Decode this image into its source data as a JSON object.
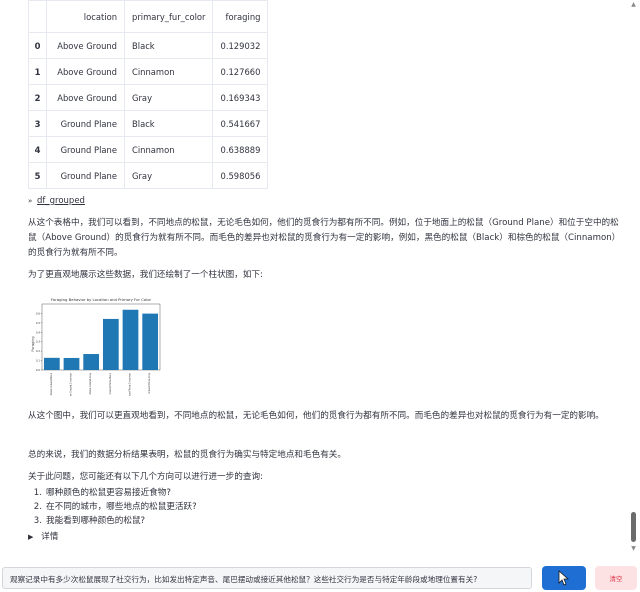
{
  "table": {
    "columns": [
      "",
      "location",
      "primary_fur_color",
      "foraging"
    ],
    "rows": [
      {
        "idx": "0",
        "location": "Above Ground",
        "color": "Black",
        "foraging": "0.129032"
      },
      {
        "idx": "1",
        "location": "Above Ground",
        "color": "Cinnamon",
        "foraging": "0.127660"
      },
      {
        "idx": "2",
        "location": "Above Ground",
        "color": "Gray",
        "foraging": "0.169343"
      },
      {
        "idx": "3",
        "location": "Ground Plane",
        "color": "Black",
        "foraging": "0.541667"
      },
      {
        "idx": "4",
        "location": "Ground Plane",
        "color": "Cinnamon",
        "foraging": "0.638889"
      },
      {
        "idx": "5",
        "location": "Ground Plane",
        "color": "Gray",
        "foraging": "0.598056"
      }
    ]
  },
  "expander": {
    "label": "df_grouped"
  },
  "paragraphs": {
    "p1": "从这个表格中，我们可以看到，不同地点的松鼠，无论毛色如何，他们的觅食行为都有所不同。例如，位于地面上的松鼠（Ground Plane）和位于空中的松鼠（Above Ground）的觅食行为就有所不同。而毛色的差异也对松鼠的觅食行为有一定的影响，例如，黑色的松鼠（Black）和棕色的松鼠（Cinnamon）的觅食行为就有所不同。",
    "p2": "为了更直观地展示这些数据，我们还绘制了一个柱状图，如下:",
    "p3": "从这个图中，我们可以更直观地看到，不同地点的松鼠，无论毛色如何，他们的觅食行为都有所不同。而毛色的差异也对松鼠的觅食行为有一定的影响。",
    "p4": "总的来说，我们的数据分析结果表明，松鼠的觅食行为确实与特定地点和毛色有关。",
    "p5": "关于此问题，您可能还有以下几个方向可以进行进一步的查询:"
  },
  "suggestions": [
    {
      "num": "1.",
      "text": "哪种颜色的松鼠更容易接近食物?"
    },
    {
      "num": "2.",
      "text": "在不同的城市，哪些地点的松鼠更活跃?"
    },
    {
      "num": "3.",
      "text": "我能看到哪种颜色的松鼠?"
    }
  ],
  "details_label": "详情",
  "chat_input": {
    "value": "观察记录中有多少次松鼠展现了社交行为，比如发出特定声音、尾巴摆动或接近其他松鼠？这些社交行为是否与特定年龄段或地理位置有关?"
  },
  "buttons": {
    "clear_label": "清空"
  },
  "colors": {
    "bar": "#1f77b4",
    "send": "#1f6ed4",
    "clear_bg": "#fde2e4",
    "clear_text": "#e0394b"
  },
  "chart_data": {
    "type": "bar",
    "title": "Foraging Behavior by Location and Primary Fur Color",
    "xlabel": "",
    "ylabel": "Foraging",
    "categories": [
      "Above Ground,Black",
      "Above Ground,Cinnamon",
      "Above Ground,Gray",
      "Ground Plane,Black",
      "Ground Plane,Cinnamon",
      "Ground Plane,Gray"
    ],
    "values": [
      0.129032,
      0.12766,
      0.169343,
      0.541667,
      0.638889,
      0.598056
    ],
    "ylim": [
      0,
      0.7
    ],
    "yticks": [
      0.0,
      0.1,
      0.2,
      0.3,
      0.4,
      0.5,
      0.6
    ],
    "grid": false
  }
}
